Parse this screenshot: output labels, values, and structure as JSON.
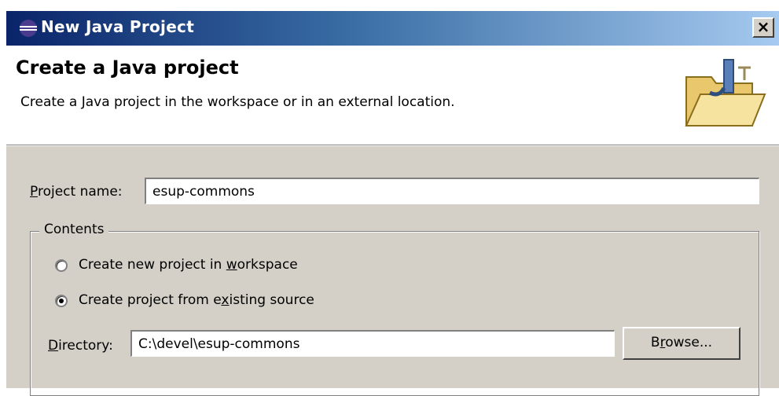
{
  "window": {
    "title": "New Java Project",
    "close_label": "×"
  },
  "banner": {
    "title": "Create a Java project",
    "description": "Create a Java project in the workspace or in an external location."
  },
  "project_name": {
    "label_accel": "P",
    "label_rest": "roject name:",
    "value": "esup-commons"
  },
  "contents": {
    "legend": "Contents",
    "options": [
      {
        "pre": "Create new project in ",
        "accel": "w",
        "post": "orkspace",
        "selected": false
      },
      {
        "pre": "Create project from e",
        "accel": "x",
        "post": "isting source",
        "selected": true
      }
    ],
    "directory": {
      "label_accel": "D",
      "label_rest": "irectory:",
      "value": "C:\\devel\\esup-commons"
    },
    "browse": {
      "pre": "B",
      "accel": "r",
      "post": "owse..."
    }
  }
}
